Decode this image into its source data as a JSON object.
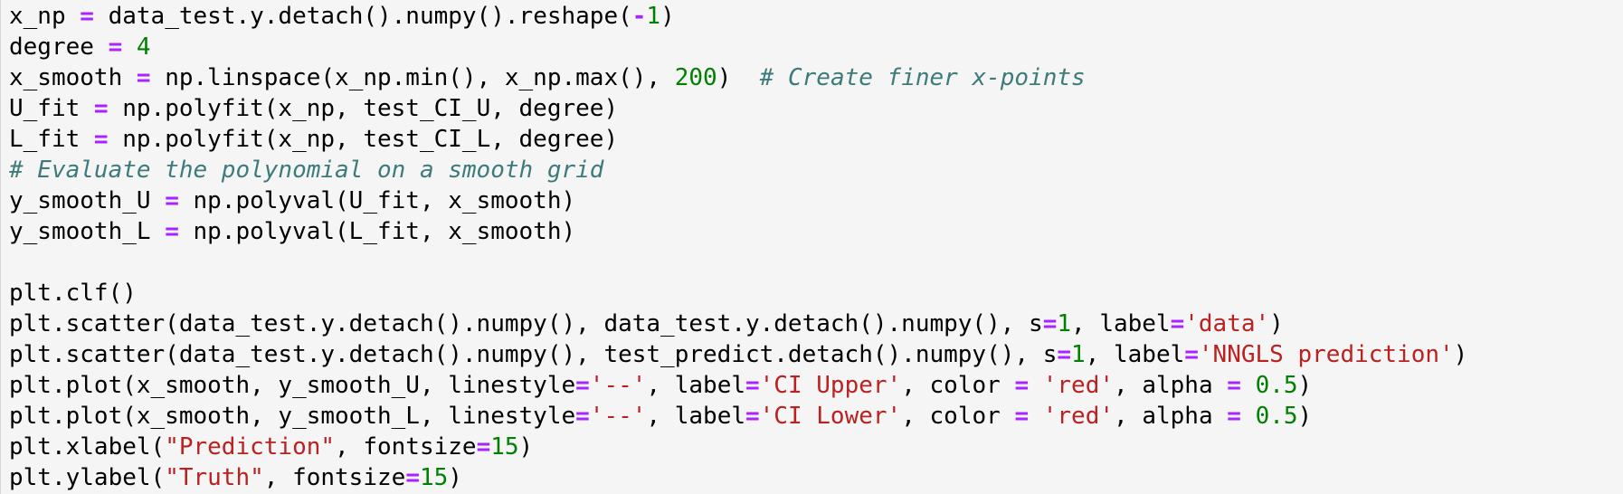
{
  "editor": {
    "colors": {
      "background": "#f5f5f5",
      "text": "#000000",
      "operator": "#aa22ff",
      "number": "#008000",
      "string": "#ba2121",
      "comment": "#3d7b7b"
    },
    "lines": [
      [
        {
          "t": "txt",
          "v": "x_np "
        },
        {
          "t": "op",
          "v": "="
        },
        {
          "t": "txt",
          "v": " data_test.y.detach().numpy().reshape("
        },
        {
          "t": "op",
          "v": "-"
        },
        {
          "t": "num",
          "v": "1"
        },
        {
          "t": "txt",
          "v": ")"
        }
      ],
      [
        {
          "t": "txt",
          "v": "degree "
        },
        {
          "t": "op",
          "v": "="
        },
        {
          "t": "txt",
          "v": " "
        },
        {
          "t": "num",
          "v": "4"
        }
      ],
      [
        {
          "t": "txt",
          "v": "x_smooth "
        },
        {
          "t": "op",
          "v": "="
        },
        {
          "t": "txt",
          "v": " np.linspace(x_np.min(), x_np.max(), "
        },
        {
          "t": "num",
          "v": "200"
        },
        {
          "t": "txt",
          "v": ")  "
        },
        {
          "t": "com",
          "v": "# Create finer x-points"
        }
      ],
      [
        {
          "t": "txt",
          "v": "U_fit "
        },
        {
          "t": "op",
          "v": "="
        },
        {
          "t": "txt",
          "v": " np.polyfit(x_np, test_CI_U, degree)"
        }
      ],
      [
        {
          "t": "txt",
          "v": "L_fit "
        },
        {
          "t": "op",
          "v": "="
        },
        {
          "t": "txt",
          "v": " np.polyfit(x_np, test_CI_L, degree)"
        }
      ],
      [
        {
          "t": "com",
          "v": "# Evaluate the polynomial on a smooth grid"
        }
      ],
      [
        {
          "t": "txt",
          "v": "y_smooth_U "
        },
        {
          "t": "op",
          "v": "="
        },
        {
          "t": "txt",
          "v": " np.polyval(U_fit, x_smooth)"
        }
      ],
      [
        {
          "t": "txt",
          "v": "y_smooth_L "
        },
        {
          "t": "op",
          "v": "="
        },
        {
          "t": "txt",
          "v": " np.polyval(L_fit, x_smooth)"
        }
      ],
      [],
      [
        {
          "t": "txt",
          "v": "plt.clf()"
        }
      ],
      [
        {
          "t": "txt",
          "v": "plt.scatter(data_test.y.detach().numpy(), data_test.y.detach().numpy(), s"
        },
        {
          "t": "op",
          "v": "="
        },
        {
          "t": "num",
          "v": "1"
        },
        {
          "t": "txt",
          "v": ", label"
        },
        {
          "t": "op",
          "v": "="
        },
        {
          "t": "str",
          "v": "'data'"
        },
        {
          "t": "txt",
          "v": ")"
        }
      ],
      [
        {
          "t": "txt",
          "v": "plt.scatter(data_test.y.detach().numpy(), test_predict.detach().numpy(), s"
        },
        {
          "t": "op",
          "v": "="
        },
        {
          "t": "num",
          "v": "1"
        },
        {
          "t": "txt",
          "v": ", label"
        },
        {
          "t": "op",
          "v": "="
        },
        {
          "t": "str",
          "v": "'NNGLS prediction'"
        },
        {
          "t": "txt",
          "v": ")"
        }
      ],
      [
        {
          "t": "txt",
          "v": "plt.plot(x_smooth, y_smooth_U, linestyle"
        },
        {
          "t": "op",
          "v": "="
        },
        {
          "t": "str",
          "v": "'--'"
        },
        {
          "t": "txt",
          "v": ", label"
        },
        {
          "t": "op",
          "v": "="
        },
        {
          "t": "str",
          "v": "'CI Upper'"
        },
        {
          "t": "txt",
          "v": ", color "
        },
        {
          "t": "op",
          "v": "="
        },
        {
          "t": "txt",
          "v": " "
        },
        {
          "t": "str",
          "v": "'red'"
        },
        {
          "t": "txt",
          "v": ", alpha "
        },
        {
          "t": "op",
          "v": "="
        },
        {
          "t": "txt",
          "v": " "
        },
        {
          "t": "num",
          "v": "0.5"
        },
        {
          "t": "txt",
          "v": ")"
        }
      ],
      [
        {
          "t": "txt",
          "v": "plt.plot(x_smooth, y_smooth_L, linestyle"
        },
        {
          "t": "op",
          "v": "="
        },
        {
          "t": "str",
          "v": "'--'"
        },
        {
          "t": "txt",
          "v": ", label"
        },
        {
          "t": "op",
          "v": "="
        },
        {
          "t": "str",
          "v": "'CI Lower'"
        },
        {
          "t": "txt",
          "v": ", color "
        },
        {
          "t": "op",
          "v": "="
        },
        {
          "t": "txt",
          "v": " "
        },
        {
          "t": "str",
          "v": "'red'"
        },
        {
          "t": "txt",
          "v": ", alpha "
        },
        {
          "t": "op",
          "v": "="
        },
        {
          "t": "txt",
          "v": " "
        },
        {
          "t": "num",
          "v": "0.5"
        },
        {
          "t": "txt",
          "v": ")"
        }
      ],
      [
        {
          "t": "txt",
          "v": "plt.xlabel("
        },
        {
          "t": "str",
          "v": "\"Prediction\""
        },
        {
          "t": "txt",
          "v": ", fontsize"
        },
        {
          "t": "op",
          "v": "="
        },
        {
          "t": "num",
          "v": "15"
        },
        {
          "t": "txt",
          "v": ")"
        }
      ],
      [
        {
          "t": "txt",
          "v": "plt.ylabel("
        },
        {
          "t": "str",
          "v": "\"Truth\""
        },
        {
          "t": "txt",
          "v": ", fontsize"
        },
        {
          "t": "op",
          "v": "="
        },
        {
          "t": "num",
          "v": "15"
        },
        {
          "t": "txt",
          "v": ")"
        }
      ]
    ]
  }
}
